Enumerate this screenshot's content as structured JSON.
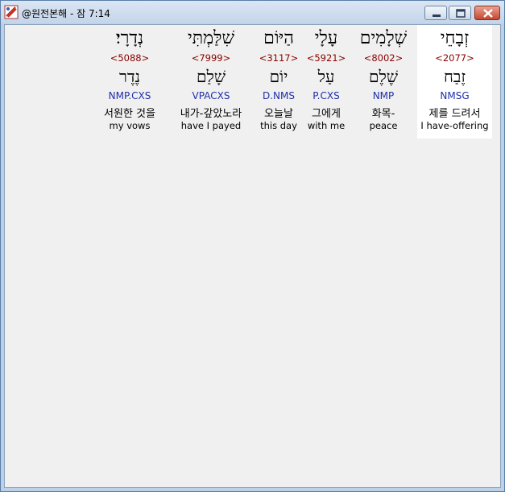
{
  "window": {
    "title": "@원전본해 - 잠 7:14",
    "controls": {
      "minimize": "minimize",
      "maximize": "maximize",
      "close": "close"
    }
  },
  "words": [
    {
      "hebrew": "זְבָחֵי",
      "strong": "<2077>",
      "lemma": "זֶבַח",
      "parse": "NMSG",
      "korean": "제를 드려서",
      "english": "I have-offering",
      "selected": true
    },
    {
      "hebrew": "שְׁלָמִים",
      "strong": "<8002>",
      "lemma": "שֶׁלֶם",
      "parse": "NMP",
      "korean": "화목-",
      "english": "peace",
      "selected": false
    },
    {
      "hebrew": "עָלָי",
      "strong": "<5921>",
      "lemma": "עַל",
      "parse": "P.CXS",
      "korean": "그에게",
      "english": "with me",
      "selected": false
    },
    {
      "hebrew": "הַיּוֹם",
      "strong": "<3117>",
      "lemma": "יוֹם",
      "parse": "D.NMS",
      "korean": "오늘날",
      "english": "this day",
      "selected": false
    },
    {
      "hebrew": "שִׁלַּמְתִּי",
      "strong": "<7999>",
      "lemma": "שָׁלַם",
      "parse": "VPACXS",
      "korean": "내가-갚았노라",
      "english": "have I payed",
      "selected": false
    },
    {
      "hebrew": "נְדָרָי׃",
      "strong": "<5088>",
      "lemma": "נֶדֶר",
      "parse": "NMP.CXS",
      "korean": "서원한 것을",
      "english": "my vows",
      "selected": false
    }
  ]
}
